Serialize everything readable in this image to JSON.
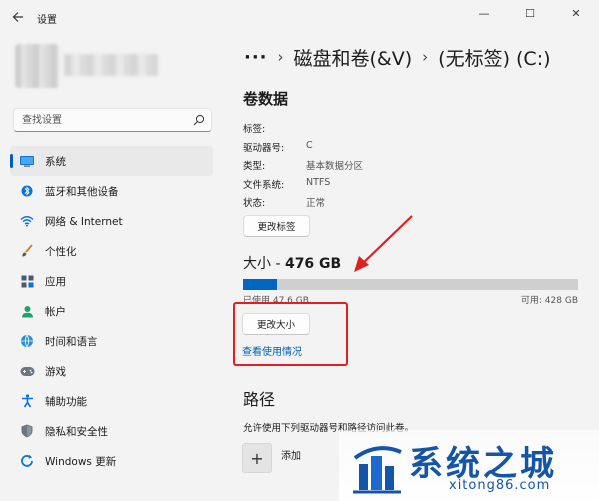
{
  "window": {
    "app_title": "设置",
    "minimize_glyph": "—",
    "maximize_glyph": "☐",
    "close_glyph": "✕"
  },
  "search": {
    "placeholder": "查找设置"
  },
  "sidebar": {
    "items": [
      {
        "label": "系统",
        "icon": "system-icon",
        "selected": true
      },
      {
        "label": "蓝牙和其他设备",
        "icon": "bluetooth-icon"
      },
      {
        "label": "网络 & Internet",
        "icon": "wifi-icon"
      },
      {
        "label": "个性化",
        "icon": "brush-icon"
      },
      {
        "label": "应用",
        "icon": "apps-icon"
      },
      {
        "label": "帐户",
        "icon": "account-icon"
      },
      {
        "label": "时间和语言",
        "icon": "globe-icon"
      },
      {
        "label": "游戏",
        "icon": "gamepad-icon"
      },
      {
        "label": "辅助功能",
        "icon": "accessibility-icon"
      },
      {
        "label": "隐私和安全性",
        "icon": "shield-icon"
      },
      {
        "label": "Windows 更新",
        "icon": "update-icon"
      }
    ]
  },
  "breadcrumb": {
    "more": "···",
    "items": [
      "磁盘和卷(&V)",
      "(无标签) (C:)"
    ]
  },
  "volume": {
    "title": "卷数据",
    "rows": [
      {
        "key": "标签:",
        "value": ""
      },
      {
        "key": "驱动器号:",
        "value": "C"
      },
      {
        "key": "类型:",
        "value": "基本数据分区"
      },
      {
        "key": "文件系统:",
        "value": "NTFS"
      },
      {
        "key": "状态:",
        "value": "正常"
      }
    ],
    "change_label_button": "更改标签"
  },
  "size": {
    "prefix": "大小 - ",
    "value": "476 GB",
    "used_fraction": 0.1,
    "used_label": "已使用 47.6 GB",
    "free_label": "可用: 428 GB",
    "resize_button": "更改大小",
    "view_usage_link": "查看使用情况"
  },
  "path": {
    "title": "路径",
    "description": "允许使用下列驱动器号和路径访问此卷。",
    "add_label": "添加",
    "add_glyph": "+"
  },
  "watermark": {
    "brand": "系统之城",
    "url": "xitong86.com"
  },
  "colors": {
    "accent": "#005fb8",
    "usage_fill": "#0067c0",
    "annotation": "#e02020",
    "watermark": "#1455a8"
  }
}
